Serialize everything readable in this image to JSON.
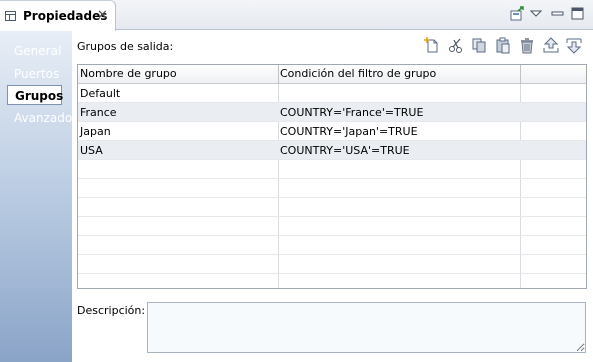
{
  "view": {
    "tab_title": "Propiedades",
    "close_glyph": "✕"
  },
  "nav": {
    "items": [
      {
        "label": "General"
      },
      {
        "label": "Puertos"
      },
      {
        "label": "Grupos",
        "selected": true
      },
      {
        "label": "Avanzado"
      }
    ]
  },
  "panel": {
    "groups_label": "Grupos de salida:",
    "toolbar_icons": [
      "new-icon",
      "cut-icon",
      "copy-icon",
      "paste-icon",
      "delete-icon",
      "move-up-icon",
      "move-down-icon"
    ],
    "description_label": "Descripción:"
  },
  "table": {
    "headers": [
      "Nombre de grupo",
      "Condición del filtro de grupo"
    ],
    "rows": [
      {
        "name": "Default",
        "condition": ""
      },
      {
        "name": "France",
        "condition": "COUNTRY='France'=TRUE"
      },
      {
        "name": "Japan",
        "condition": "COUNTRY='Japan'=TRUE"
      },
      {
        "name": "USA",
        "condition": "COUNTRY='USA'=TRUE"
      }
    ]
  },
  "colors": {
    "accent": "#8aa4c8",
    "row_alt": "#eaeef3"
  }
}
